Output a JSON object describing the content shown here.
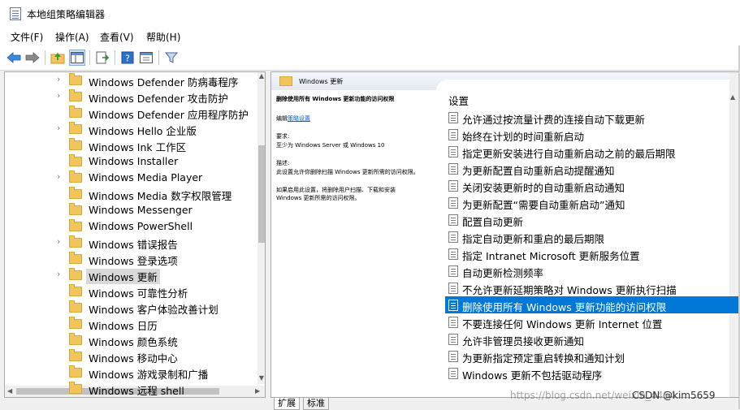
{
  "window": {
    "title": "本地组策略编辑器"
  },
  "menu": [
    "文件(F)",
    "操作(A)",
    "查看(V)",
    "帮助(H)"
  ],
  "toolbar": {
    "icons": [
      "back-arrow-icon",
      "forward-arrow-icon",
      "up-folder-icon",
      "show-hide-tree-icon",
      "export-list-icon",
      "help-icon",
      "properties-icon",
      "filter-icon"
    ]
  },
  "tree": {
    "items": [
      {
        "label": "Windows Defender 防病毒程序",
        "expandable": true
      },
      {
        "label": "Windows Defender 攻击防护",
        "expandable": true
      },
      {
        "label": "Windows Defender 应用程序防护",
        "expandable": false
      },
      {
        "label": "Windows Hello 企业版",
        "expandable": true
      },
      {
        "label": "Windows Ink 工作区",
        "expandable": false
      },
      {
        "label": "Windows Installer",
        "expandable": false
      },
      {
        "label": "Windows Media Player",
        "expandable": true
      },
      {
        "label": "Windows Media 数字权限管理",
        "expandable": false
      },
      {
        "label": "Windows Messenger",
        "expandable": false
      },
      {
        "label": "Windows PowerShell",
        "expandable": false
      },
      {
        "label": "Windows 错误报告",
        "expandable": true
      },
      {
        "label": "Windows 登录选项",
        "expandable": false
      },
      {
        "label": "Windows 更新",
        "expandable": true,
        "selected": true
      },
      {
        "label": "Windows 可靠性分析",
        "expandable": false
      },
      {
        "label": "Windows 客户体验改善计划",
        "expandable": false
      },
      {
        "label": "Windows 日历",
        "expandable": false
      },
      {
        "label": "Windows 颜色系统",
        "expandable": false
      },
      {
        "label": "Windows 移动中心",
        "expandable": false
      },
      {
        "label": "Windows 游戏录制和广播",
        "expandable": false
      },
      {
        "label": "Windows 远程 shell",
        "expandable": false
      }
    ]
  },
  "details": {
    "header": "Windows 更新",
    "policy_title": "删除使用所有 Windows 更新功能的访问权限",
    "edit_prefix": "编辑",
    "edit_link": "策略设置",
    "requirements_label": "要求:",
    "requirements": "至少为 Windows Server 或 Windows 10",
    "description_label": "描述:",
    "description": "此设置允许你删除扫描 Windows 更新所需的访问权限。",
    "extra_1": "如果启用此设置，将删除用户扫描、下载和安装",
    "extra_2": "Windows 更新所需的访问权限。"
  },
  "settings": {
    "header": "设置",
    "items": [
      "允许通过按流量计费的连接自动下载更新",
      "始终在计划的时间重新启动",
      "指定更新安装进行自动重新启动之前的最后期限",
      "为更新配置自动重新启动提醒通知",
      "关闭安装更新时的自动重新启动通知",
      "为更新配置“需要自动重新启动”通知",
      "配置自动更新",
      "指定自动更新和重启的最后期限",
      "指定 Intranet Microsoft 更新服务位置",
      "自动更新检测频率",
      "不允许更新延期策略对 Windows 更新执行扫描",
      "删除使用所有 Windows 更新功能的访问权限",
      "不要连接任何 Windows 更新 Internet 位置",
      "允许非管理员接收更新通知",
      "为更新指定预定重启转换和通知计划",
      "Windows 更新不包括驱动程序"
    ],
    "selected_index": 11
  },
  "tabs": [
    "扩展",
    "标准"
  ],
  "footer": {
    "watermark": "https://blog.csdn.net/weixin_4454",
    "credit": "CSDN @kim5659"
  }
}
